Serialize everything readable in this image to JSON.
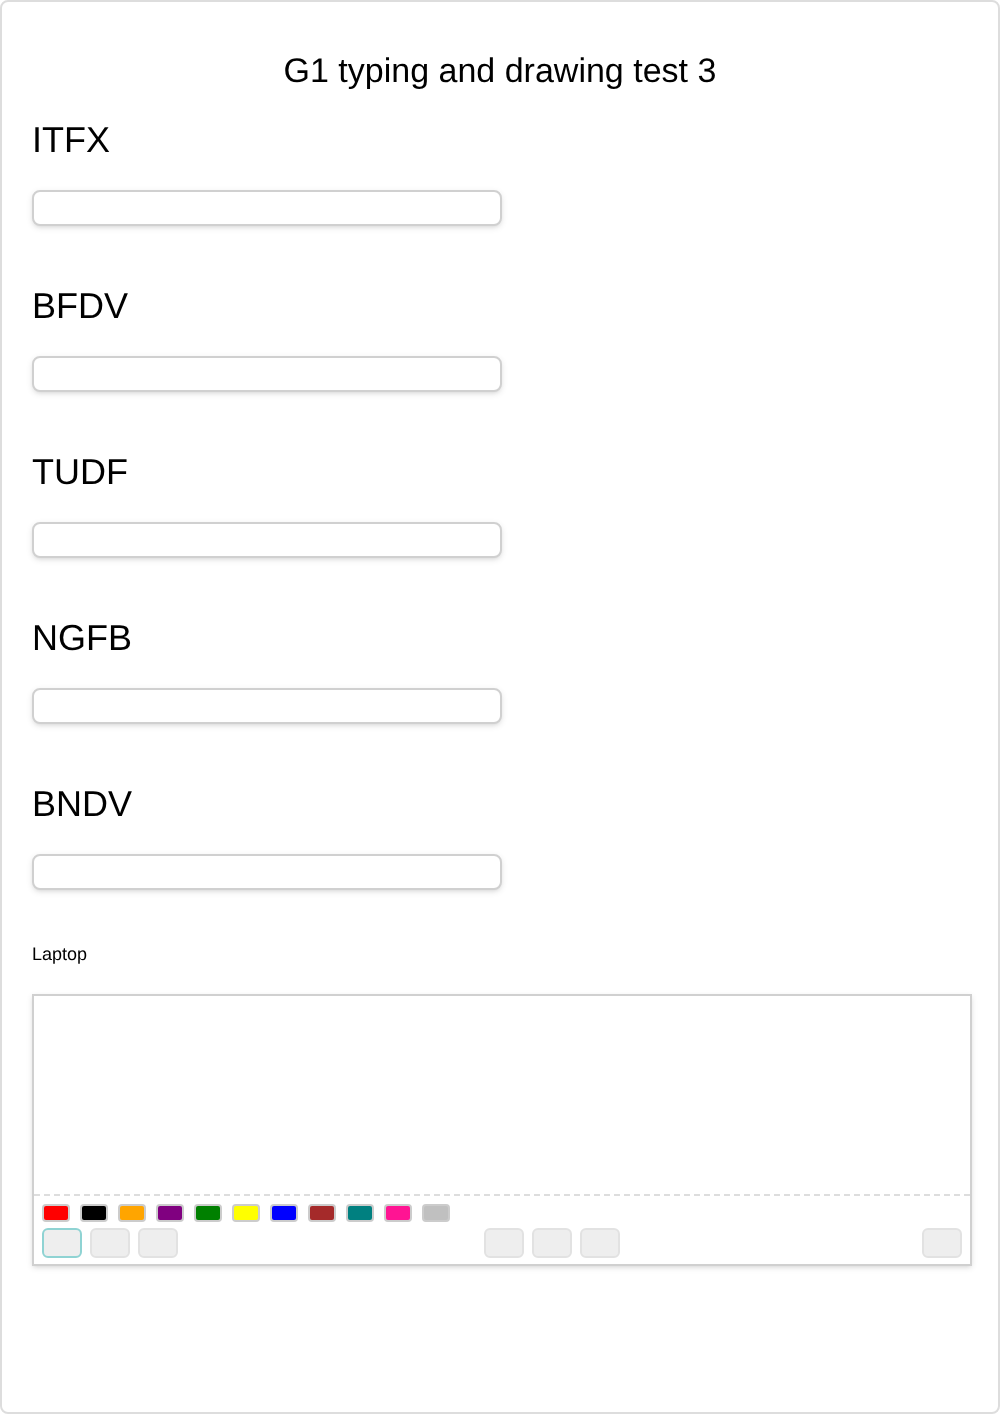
{
  "title": "G1 typing and drawing test 3",
  "questions": [
    {
      "label": "ITFX"
    },
    {
      "label": "BFDV"
    },
    {
      "label": "TUDF"
    },
    {
      "label": "NGFB"
    },
    {
      "label": "BNDV"
    }
  ],
  "drawing": {
    "label": "Laptop",
    "palette": [
      {
        "color": "#ff0000"
      },
      {
        "color": "#000000"
      },
      {
        "color": "#ffa500"
      },
      {
        "color": "#800080"
      },
      {
        "color": "#008000"
      },
      {
        "color": "#ffff00"
      },
      {
        "color": "#0000ff"
      },
      {
        "color": "#a52a2a"
      },
      {
        "color": "#008080"
      },
      {
        "color": "#ff1493"
      },
      {
        "color": "#c0c0c0"
      }
    ],
    "toolbar": [
      [
        {
          "selected": true
        },
        {
          "selected": false
        },
        {
          "selected": false
        }
      ],
      [
        {
          "selected": false
        },
        {
          "selected": false
        },
        {
          "selected": false
        }
      ],
      [
        {
          "selected": false
        }
      ]
    ]
  }
}
